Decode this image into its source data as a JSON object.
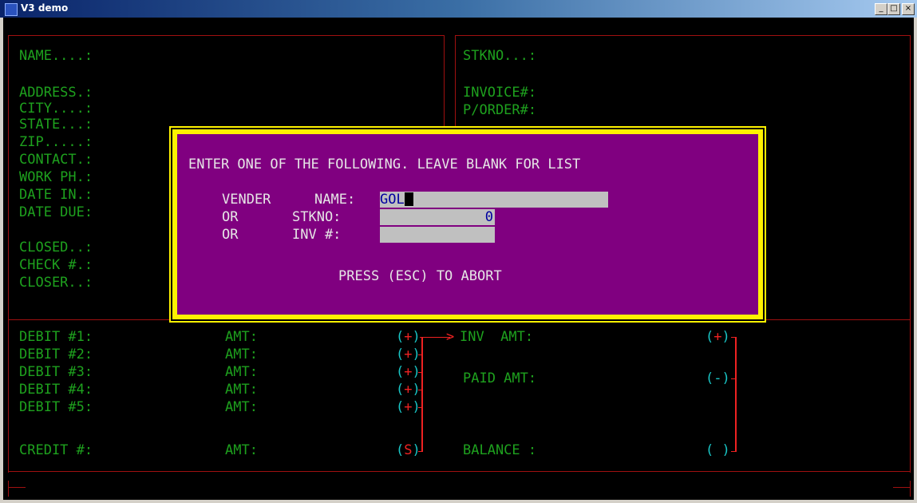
{
  "window": {
    "title": "V3 demo",
    "minimize": "_",
    "maximize": "□",
    "close": "×"
  },
  "left_form": {
    "name": "NAME....:",
    "address": "ADDRESS.:",
    "city": "CITY....:",
    "state": "STATE...:",
    "zip": "ZIP.....:",
    "contact": "CONTACT.:",
    "work_ph": "WORK PH.:",
    "date_in": "DATE IN.:",
    "date_due": "DATE DUE:",
    "closed": "CLOSED..:",
    "check": "CHECK #.:",
    "closer": "CLOSER..:"
  },
  "right_form": {
    "stkno": "STKNO...:",
    "invoice": "INVOICE#:",
    "porder": "P/ORDER#:"
  },
  "dialog": {
    "heading": "ENTER ONE OF THE FOLLOWING. LEAVE BLANK FOR LIST",
    "row1_prefix": "VENDER",
    "row1_label": "NAME:",
    "row1_value": "GOL",
    "row2_prefix": "OR",
    "row2_label": "STKNO:",
    "row2_value": "0",
    "row3_prefix": "OR",
    "row3_label": "INV #:",
    "row3_value": "",
    "footer": "PRESS (ESC) TO ABORT"
  },
  "ledger": {
    "debits": [
      {
        "label": "DEBIT #1:",
        "amt": "AMT:",
        "sign": "+"
      },
      {
        "label": "DEBIT #2:",
        "amt": "AMT:",
        "sign": "+"
      },
      {
        "label": "DEBIT #3:",
        "amt": "AMT:",
        "sign": "+"
      },
      {
        "label": "DEBIT #4:",
        "amt": "AMT:",
        "sign": "+"
      },
      {
        "label": "DEBIT #5:",
        "amt": "AMT:",
        "sign": "+"
      }
    ],
    "credit": {
      "label": "CREDIT #:",
      "amt": "AMT:",
      "sign": "S"
    },
    "inv_amt": {
      "label": "INV  AMT:",
      "sign": "+"
    },
    "paid_amt": {
      "label": "PAID AMT:",
      "sign": "-"
    },
    "balance": {
      "label": "BALANCE :",
      "sign": " "
    }
  },
  "colors": {
    "label": "#1ea11e",
    "border": "#a01010",
    "sign": "#e22",
    "paren": "#19c5c5",
    "dialog_bg": "#800080",
    "dialog_frame": "#fff200",
    "field_bg": "#c0c0c0",
    "field_text": "#0000a0"
  }
}
